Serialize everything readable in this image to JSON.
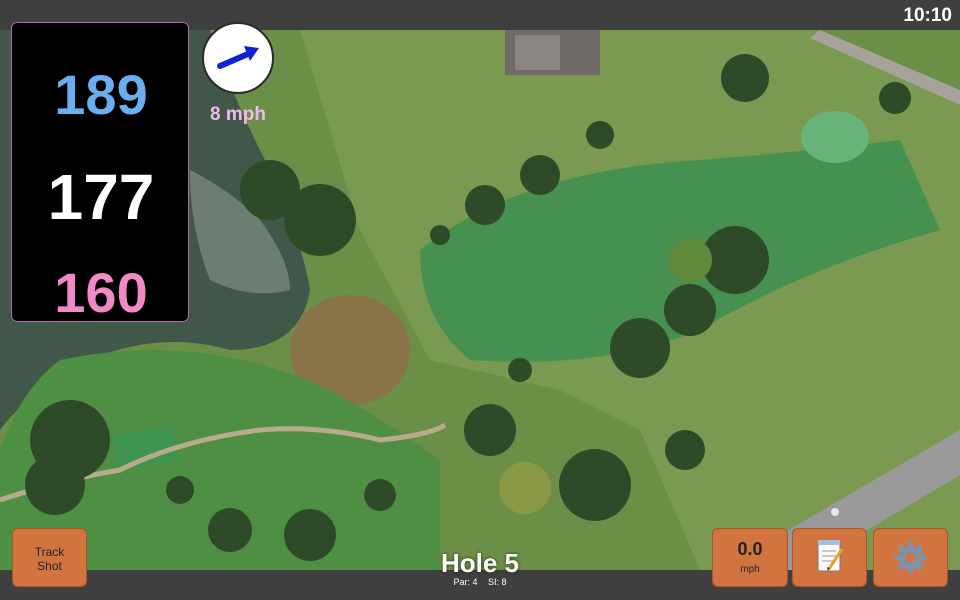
{
  "status_bar": {
    "time": "10:10"
  },
  "yardages": {
    "back": {
      "value": "189",
      "color": "#6aaef0"
    },
    "middle": {
      "value": "177",
      "color": "#ffffff"
    },
    "front": {
      "value": "160",
      "color": "#f08ac6"
    }
  },
  "wind": {
    "speed": "8 mph",
    "speed_color": "#f2b8ef",
    "arrow_color": "#1022d8",
    "icon": "wind-direction-arrow-icon"
  },
  "buttons": {
    "track_shot_line1": "Track",
    "track_shot_line2": "Shot",
    "speed_value": "0.0",
    "speed_unit": "mph",
    "notes_icon": "notepad-icon",
    "settings_icon": "gear-icon",
    "color": "#d2743f"
  },
  "hole": {
    "title": "Hole 5",
    "par": "Par: 4",
    "si": "SI: 8"
  }
}
